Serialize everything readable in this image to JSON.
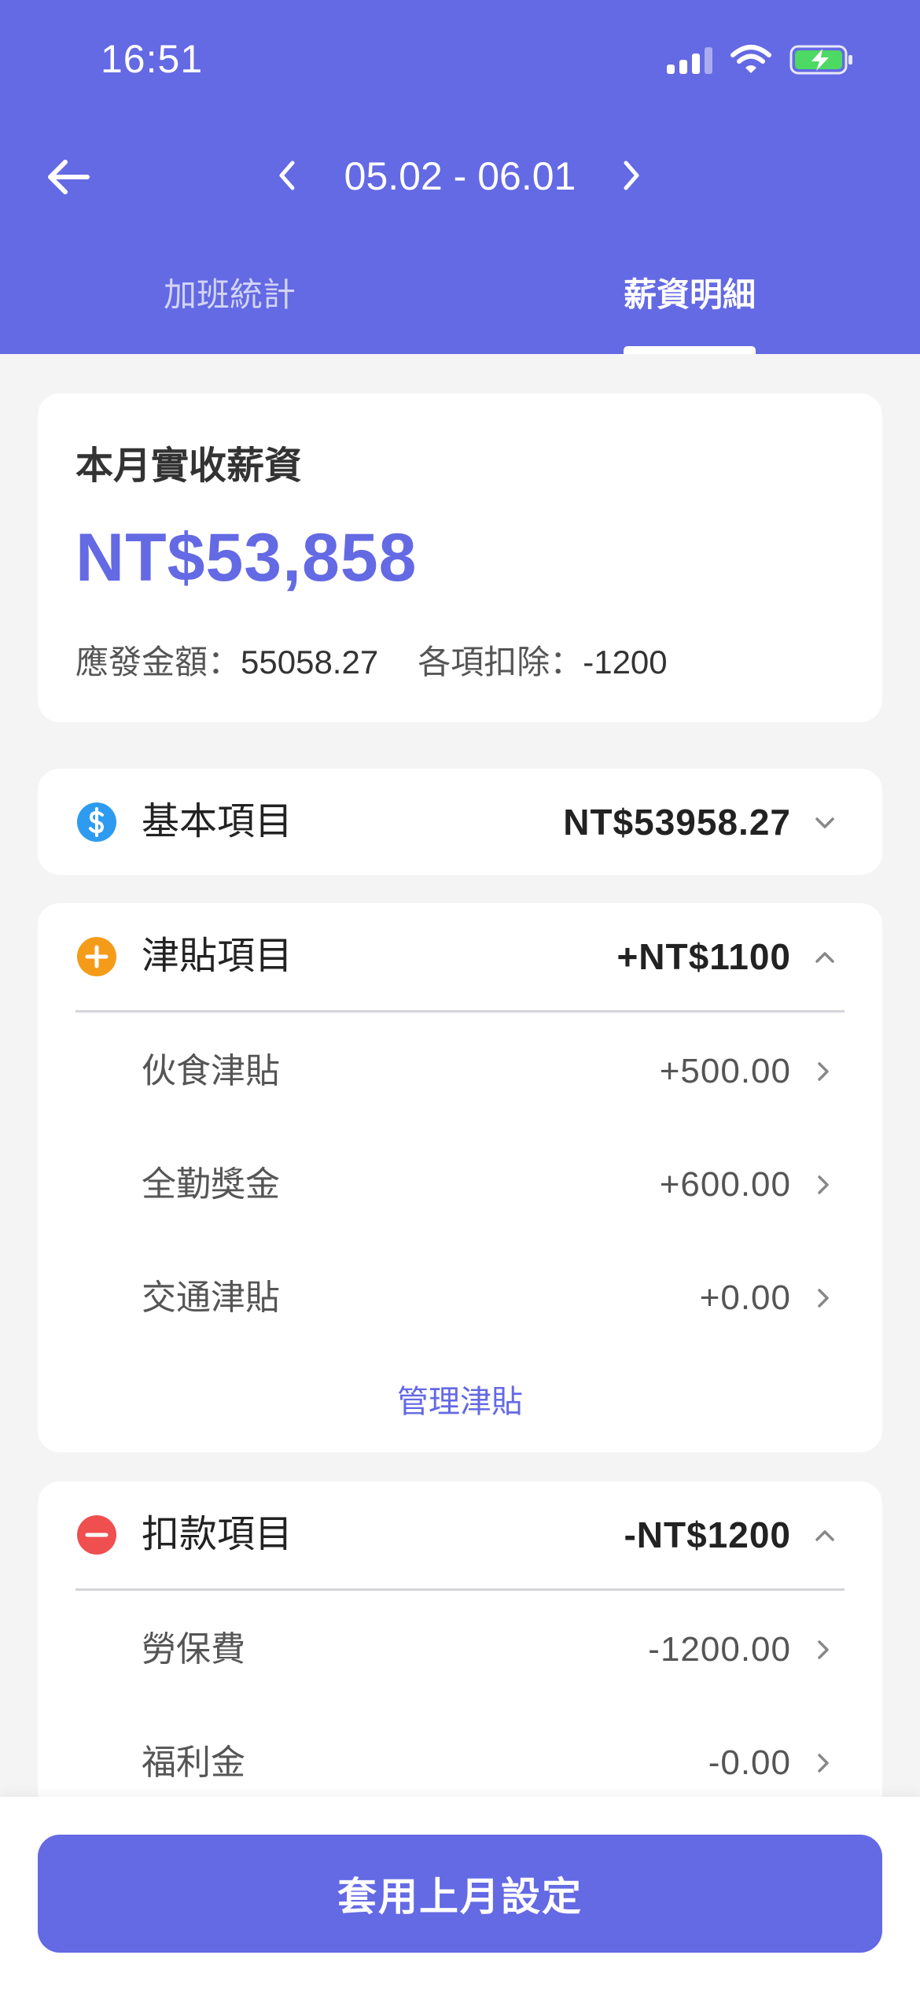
{
  "status_bar": {
    "time": "16:51"
  },
  "header": {
    "date_range": "05.02 - 06.01",
    "tabs": [
      {
        "label": "加班統計",
        "active": false
      },
      {
        "label": "薪資明細",
        "active": true
      }
    ]
  },
  "summary": {
    "title": "本月實收薪資",
    "amount": "NT$53,858",
    "gross_label": "應發金額：",
    "gross_value": "55058.27",
    "deduction_label": "各項扣除：",
    "deduction_value": "-1200"
  },
  "sections": {
    "basic": {
      "title": "基本項目",
      "amount": "NT$53958.27",
      "expanded": false
    },
    "allowance": {
      "title": "津貼項目",
      "amount": "+NT$1100",
      "expanded": true,
      "items": [
        {
          "label": "伙食津貼",
          "value": "+500.00"
        },
        {
          "label": "全勤獎金",
          "value": "+600.00"
        },
        {
          "label": "交通津貼",
          "value": "+0.00"
        }
      ],
      "manage_label": "管理津貼"
    },
    "deduction": {
      "title": "扣款項目",
      "amount": "-NT$1200",
      "expanded": true,
      "items": [
        {
          "label": "勞保費",
          "value": "-1200.00"
        },
        {
          "label": "福利金",
          "value": "-0.00"
        }
      ]
    }
  },
  "footer": {
    "apply_label": "套用上月設定"
  },
  "colors": {
    "primary": "#6469e4",
    "basic_icon": "#2d9cf0",
    "allowance_icon": "#f59b1a",
    "deduction_icon": "#ef4f4f"
  },
  "icons": {
    "back": "arrow-left-icon",
    "prev": "chevron-left-icon",
    "next": "chevron-right-icon",
    "basic": "dollar-circle-icon",
    "allowance": "plus-circle-icon",
    "deduction": "minus-circle-icon"
  }
}
